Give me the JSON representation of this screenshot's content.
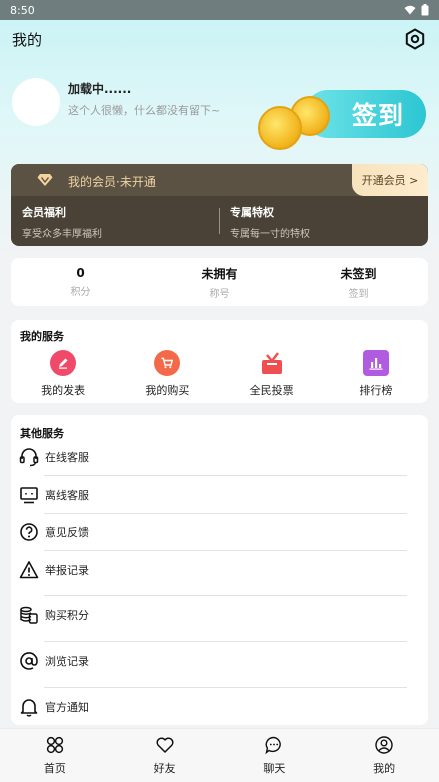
{
  "status_bar": {
    "time": "8:50",
    "wifi_icon": "wifi-icon",
    "battery_icon": "battery-icon"
  },
  "header": {
    "title": "我的",
    "settings_icon": "hexagon-settings-icon"
  },
  "profile": {
    "nickname": "加载中......",
    "bio": "这个人很懒，什么都没有留下~",
    "checkin_label": "签到"
  },
  "vip": {
    "status": "我的会员·未开通",
    "open_button": "开通会员 >",
    "benefits_title": "会员福利",
    "benefits_sub": "享受众多丰厚福利",
    "privilege_title": "专属特权",
    "privilege_sub": "专属每一寸的特权"
  },
  "stats": [
    {
      "value": "0",
      "label": "积分"
    },
    {
      "value": "未拥有",
      "label": "称号"
    },
    {
      "value": "未签到",
      "label": "签到"
    }
  ],
  "my_services": {
    "title": "我的服务",
    "items": [
      {
        "label": "我的发表",
        "icon": "pencil-icon",
        "color": "#f04a6a"
      },
      {
        "label": "我的购买",
        "icon": "cart-icon",
        "color": "#f36a4a"
      },
      {
        "label": "全民投票",
        "icon": "ballot-box-icon",
        "color": "#f04f4f"
      },
      {
        "label": "排行榜",
        "icon": "bar-chart-icon",
        "color": "#b05be0"
      }
    ]
  },
  "other_services": {
    "title": "其他服务",
    "items": [
      {
        "label": "在线客服",
        "icon": "headset-icon"
      },
      {
        "label": "离线客服",
        "icon": "monitor-icon"
      },
      {
        "label": "意见反馈",
        "icon": "question-icon"
      },
      {
        "label": "举报记录",
        "icon": "warning-icon"
      },
      {
        "label": "购买积分",
        "icon": "coins-icon"
      },
      {
        "label": "浏览记录",
        "icon": "at-icon"
      },
      {
        "label": "官方通知",
        "icon": "bell-icon"
      }
    ]
  },
  "bottom_nav": [
    {
      "label": "首页",
      "icon": "home-grid-icon"
    },
    {
      "label": "好友",
      "icon": "heart-icon"
    },
    {
      "label": "聊天",
      "icon": "chat-bubble-icon"
    },
    {
      "label": "我的",
      "icon": "user-circle-icon"
    }
  ]
}
